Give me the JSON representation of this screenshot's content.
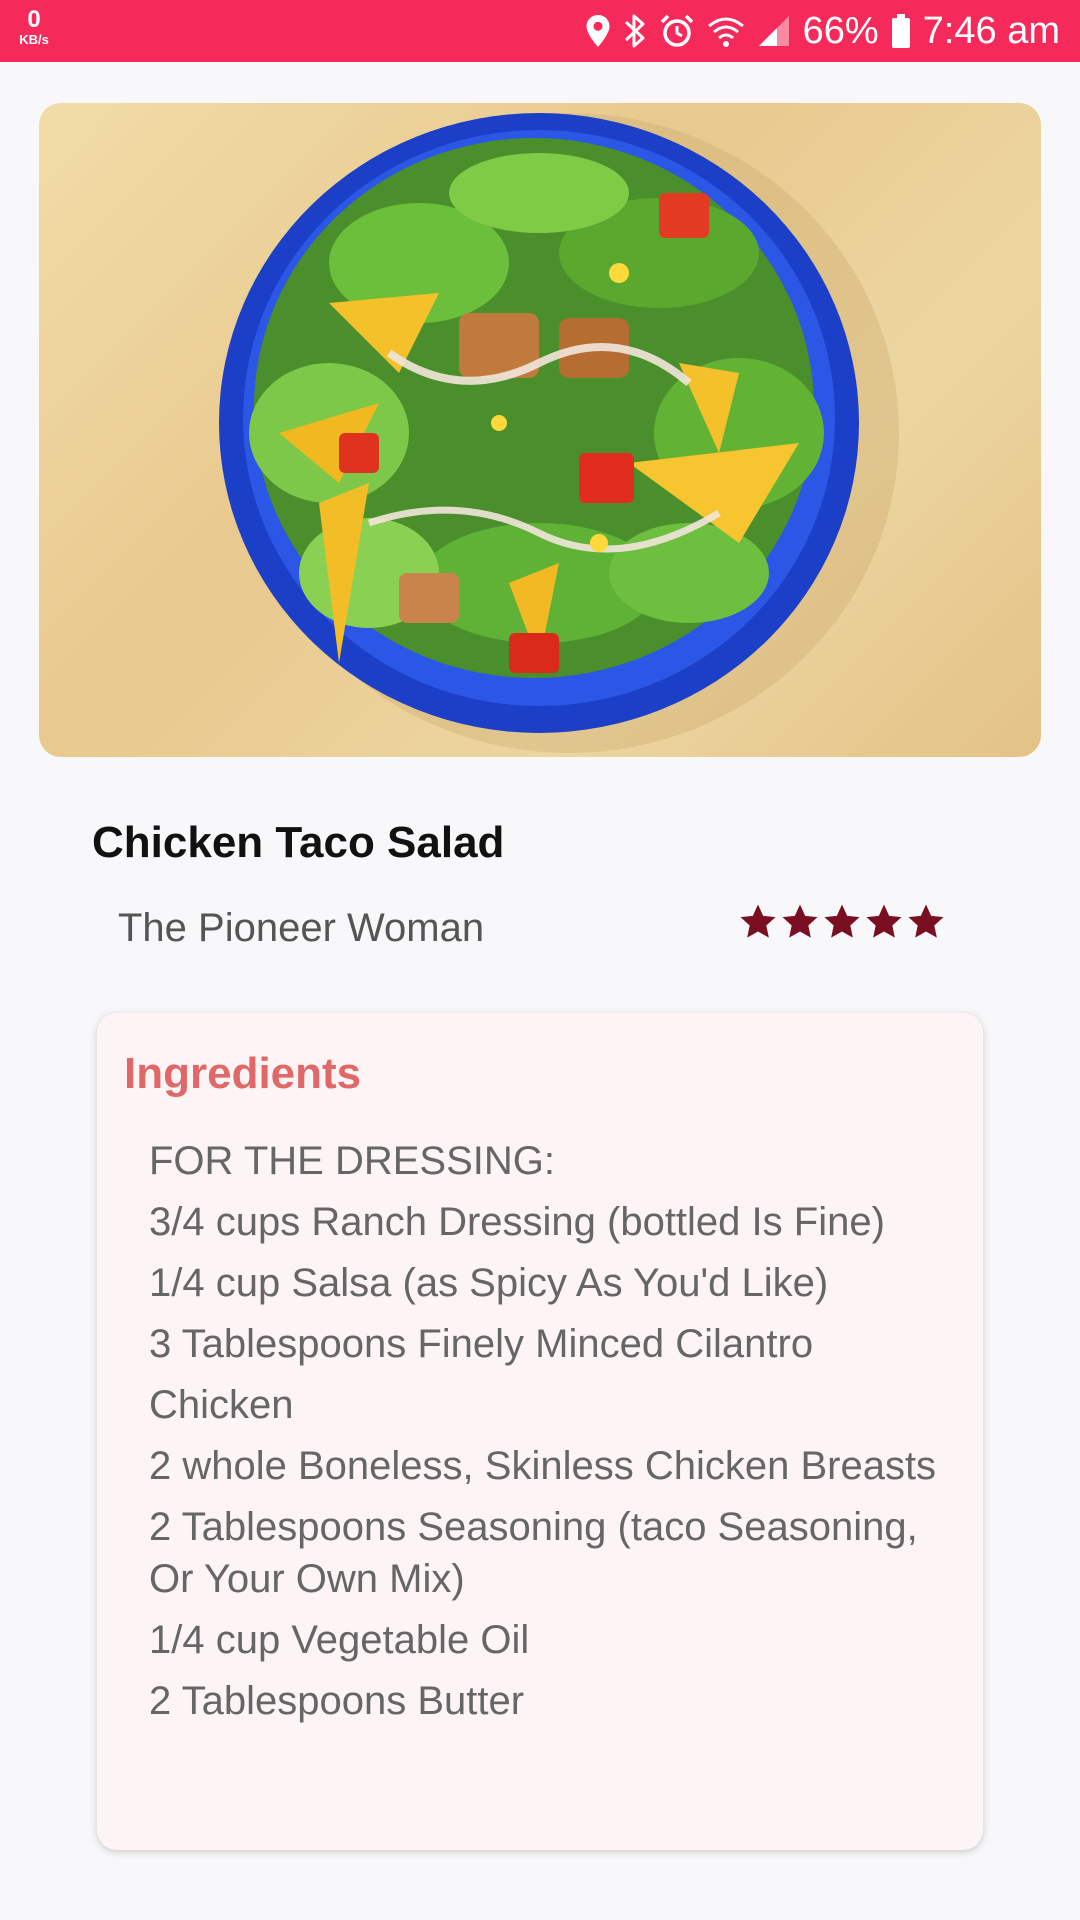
{
  "status_bar": {
    "speed_value": "0",
    "speed_unit": "KB/s",
    "battery_percent": "66%",
    "time": "7:46 am",
    "icons": [
      "location-icon",
      "bluetooth-icon",
      "alarm-icon",
      "wifi-icon",
      "signal-icon",
      "battery-icon"
    ],
    "color": "#f62a5a"
  },
  "recipe": {
    "title": "Chicken Taco Salad",
    "author": "The Pioneer Woman",
    "rating": 5,
    "rating_max": 5,
    "star_color": "#7a0f22"
  },
  "ingredients": {
    "heading": "Ingredients",
    "heading_color": "#e06868",
    "items": [
      "FOR THE DRESSING:",
      "3/4 cups Ranch Dressing (bottled Is Fine)",
      "1/4 cup Salsa (as Spicy As You'd Like)",
      "3 Tablespoons Finely Minced Cilantro",
      "Chicken",
      "2 whole Boneless, Skinless Chicken Breasts",
      "2 Tablespoons Seasoning (taco Seasoning, Or Your Own Mix)",
      "1/4 cup Vegetable Oil",
      "2 Tablespoons Butter"
    ]
  }
}
